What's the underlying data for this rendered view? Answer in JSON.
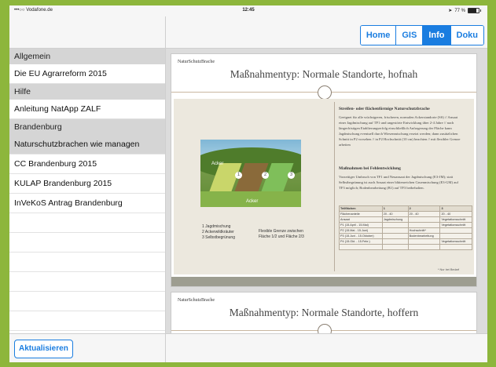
{
  "status_bar": {
    "carrier": "•••○○ Vodafone.de",
    "time": "12:45",
    "battery": "77 %"
  },
  "sidebar": {
    "sections": [
      {
        "header": "Allgemein",
        "items": [
          "Die EU Agrarreform 2015"
        ]
      },
      {
        "header": "Hilfe",
        "items": [
          "Anleitung NatApp ZALF"
        ]
      },
      {
        "header": "Brandenburg",
        "items": [
          "Naturschutzbrachen wie managen",
          "CC Brandenburg 2015",
          "KULAP Brandenburg 2015",
          "InVeKoS Antrag Brandenburg"
        ]
      }
    ],
    "refresh_label": "Aktualisieren"
  },
  "nav": {
    "tabs": [
      "Home",
      "GIS",
      "Info",
      "Doku"
    ],
    "active": "Info"
  },
  "slides": [
    {
      "logo": "NaturSchutzBrache",
      "title": "Maßnahmentyp: Normale Standorte, hofnah",
      "photo_labels": {
        "top": "Acker",
        "bottom": "Acker",
        "numbers": [
          "1",
          "2",
          "3"
        ]
      },
      "legend_left": [
        "1 Jagdmischung",
        "2 Ackerwildkräuter",
        "3 Selbstbegrünung"
      ],
      "legend_right": [
        "Flexible Grenze zwischen",
        "Fläche 1/2 und Fläche 2/3"
      ],
      "right_heading": "Streifen- oder flächenförmige Naturschutzbrache",
      "right_text": "Geeignet für alle wüchsigeren, frischeren, normalen Ackerstandorte (SS) // Ansaat einer Jagdmischung auf TF1 und ungestörte Entwicklung über 2-4 Jahre // nach längerfristigen Etablierungserfolg einschließlich Anfragerung der Fläche kann Jagdmischung eventuell durch Wiesenmischung ersetzt werden; dann zusätzlichen Schnitt in P2 vorsehen // in P2 Hochschnitt (10 cm) beachten // mit flexibler Grenze arbeiten",
      "sub_heading": "Maßnahmen bei Fehlentwicklung",
      "sub_text": "Vorzeitiger Umbruch von TF1 und Neuansaat der Jagdmischung (E3-JM); statt Selbstbegrünung ist auch Ansaat einer blütenreichen Gruenmischung (E3-GM) auf TF3 möglich; Bodenbearbeitung (B1) auf TF3 beibehalten.",
      "table": [
        [
          "Teilflächen",
          "1",
          "2",
          "3"
        ],
        [
          "Flächenanteile",
          "20 - 40",
          "20 - 40",
          "20 - 40"
        ],
        [
          "Ansaat",
          "Jagdmischung",
          "",
          "Vegetationsschnitt"
        ],
        [
          "P1 (15.April - 15.Mai)",
          "",
          "",
          "Vegetationsschnitt"
        ],
        [
          "P2 (15.Mai - 15.Juni)",
          "",
          "Hochschnitt*",
          ""
        ],
        [
          "P3 (15.Juni - 15.Oktober)",
          "",
          "Bodenbearbeitung",
          ""
        ],
        [
          "P4 (15.Okt. - 15.Febr.)",
          "",
          "",
          "Vegetationsschnitt"
        ],
        [
          "",
          "",
          "",
          ""
        ]
      ],
      "table_note": "* Nur bei Bedarf"
    },
    {
      "logo": "NaturSchutzBrache",
      "title": "Maßnahmentyp: Normale Standorte, hoffern"
    }
  ]
}
